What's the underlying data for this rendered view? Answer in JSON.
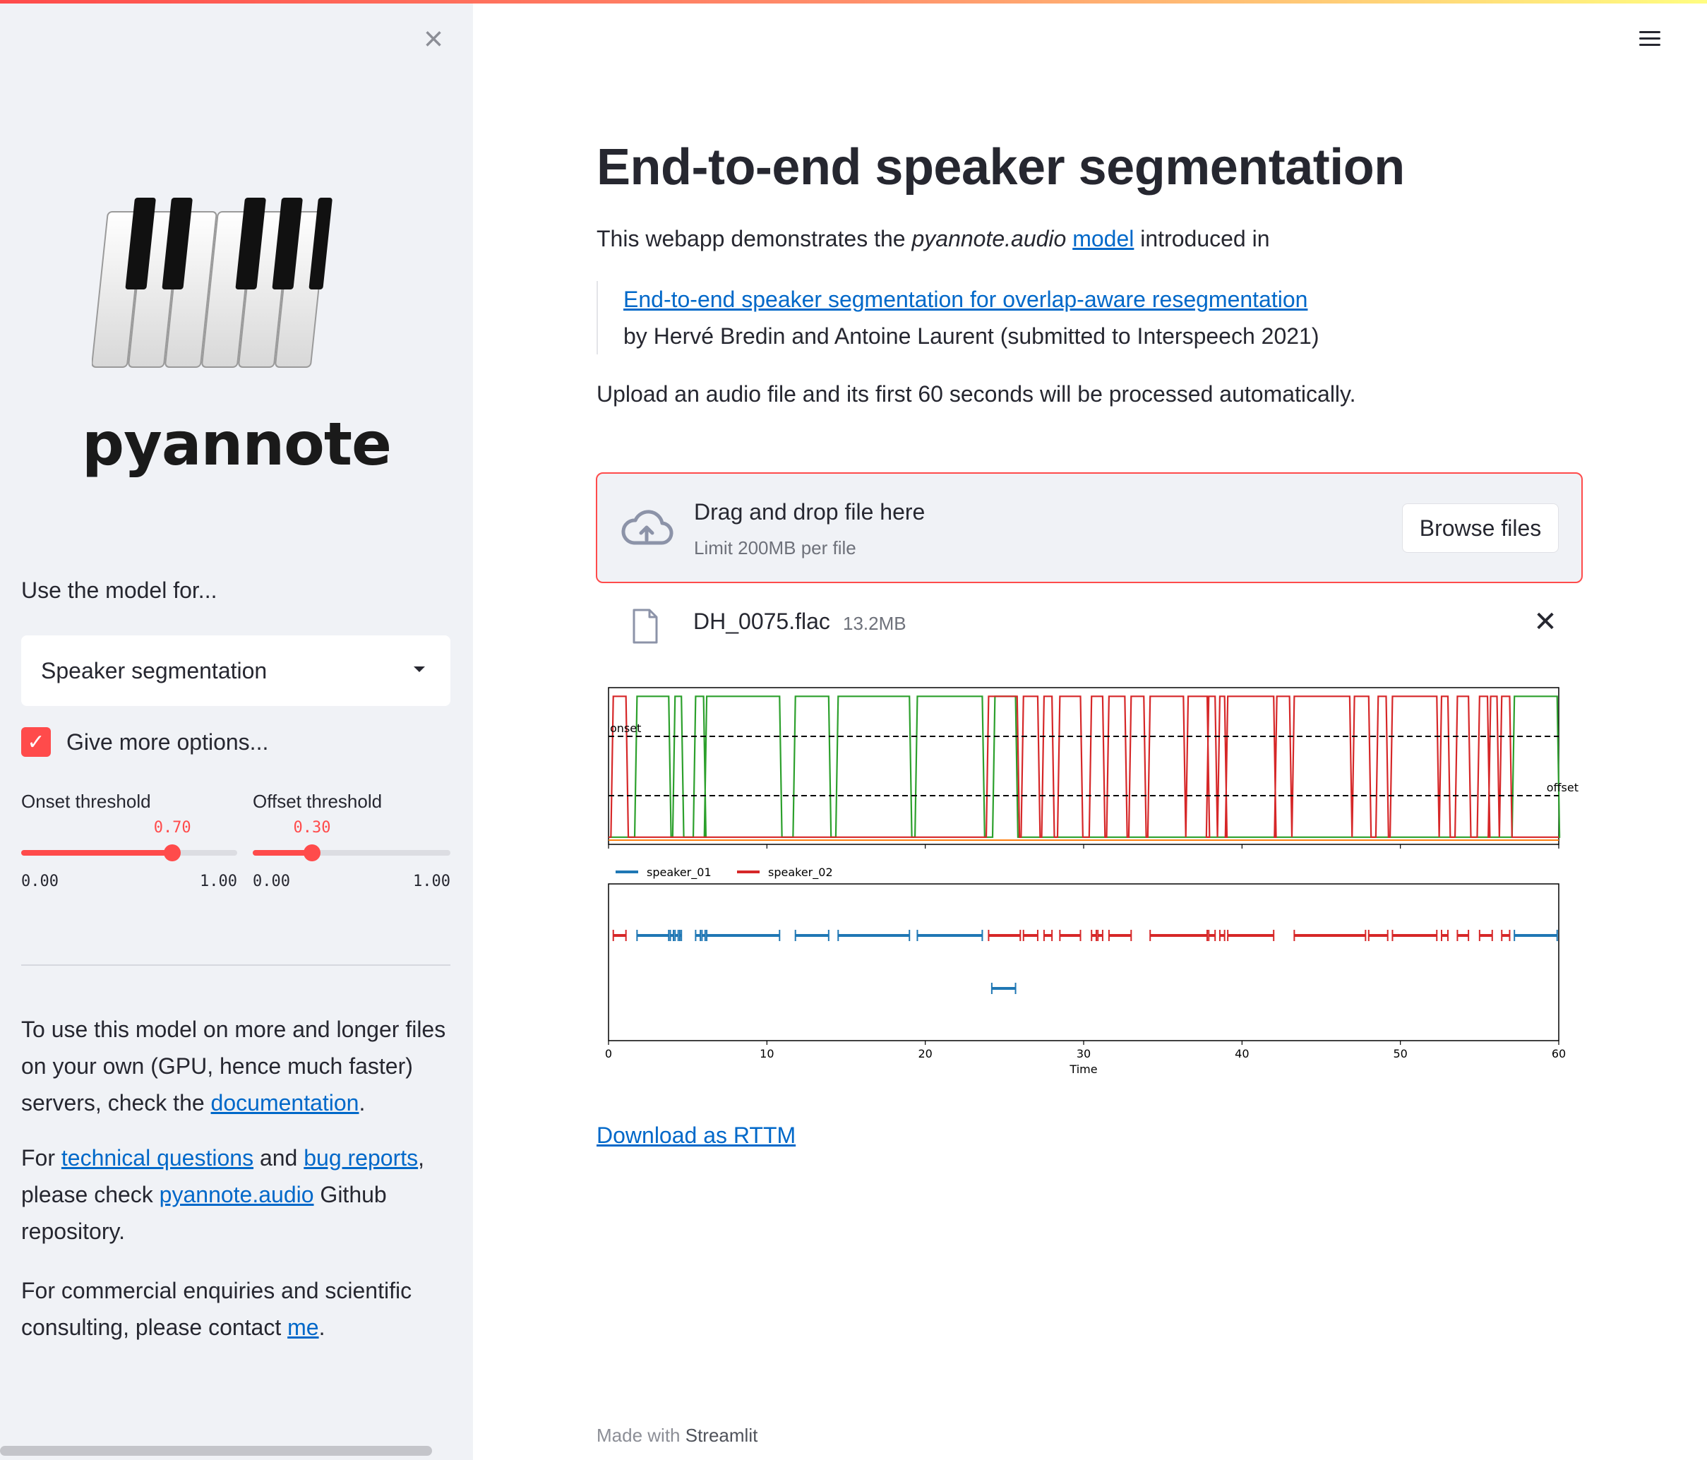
{
  "sidebar": {
    "close_label": "×",
    "logo_text": "pyannote",
    "use_label": "Use the model for...",
    "select_value": "Speaker segmentation",
    "checkbox_label": "Give more options...",
    "onset": {
      "title": "Onset threshold",
      "value": 0.7,
      "value_text": "0.70",
      "min": "0.00",
      "max": "1.00"
    },
    "offset": {
      "title": "Offset threshold",
      "value": 0.3,
      "value_text": "0.30",
      "min": "0.00",
      "max": "1.00"
    },
    "p1": {
      "a": "To use this model on more and longer files on your own (GPU, hence much faster) servers, check the ",
      "link": "documentation",
      "b": "."
    },
    "p2": {
      "a": "For ",
      "link1": "technical questions",
      "b": " and ",
      "link2": "bug reports",
      "c": ", please check ",
      "link3": "pyannote.audio",
      "d": " Github repository."
    },
    "p3": {
      "a": "For commercial enquiries and scientific consulting, please contact ",
      "link": "me",
      "b": "."
    }
  },
  "main": {
    "title": "End-to-end speaker segmentation",
    "intro": {
      "a": "This webapp demonstrates the ",
      "em": "pyannote.audio",
      "link": "model",
      "b": " introduced in"
    },
    "quote": {
      "link": "End-to-end speaker segmentation for overlap-aware resegmentation",
      "by": "by Hervé Bredin and Antoine Laurent (submitted to Interspeech 2021)"
    },
    "upload_note": "Upload an audio file and its first 60 seconds will be processed automatically.",
    "uploader": {
      "title": "Drag and drop file here",
      "limit": "Limit 200MB per file",
      "browse": "Browse files"
    },
    "file": {
      "name": "DH_0075.flac",
      "size": "13.2MB"
    },
    "download": "Download as RTTM",
    "footer": {
      "a": "Made with ",
      "b": "Streamlit"
    }
  },
  "chart_data": {
    "type": "line",
    "onset_label": "onset",
    "offset_label": "offset",
    "onset": 0.7,
    "offset": 0.3,
    "xlabel": "Time",
    "xlim": [
      0,
      60
    ],
    "xticks": [
      0,
      10,
      20,
      30,
      40,
      50,
      60
    ],
    "legend": [
      {
        "name": "speaker_01",
        "color": "#1f77b4"
      },
      {
        "name": "speaker_02",
        "color": "#d62728"
      }
    ],
    "colors": {
      "score_green": "#2ca02c",
      "score_red": "#d62728",
      "score_orange": "#ff7f0e"
    },
    "green_segments": [
      [
        1.8,
        3.8
      ],
      [
        4.2,
        4.6
      ],
      [
        5.5,
        6.0
      ],
      [
        6.2,
        10.8
      ],
      [
        11.8,
        13.9
      ],
      [
        14.5,
        19.0
      ],
      [
        19.5,
        23.6
      ],
      [
        24.4,
        25.7
      ]
    ],
    "red_segments": [
      [
        0.3,
        1.1
      ],
      [
        24.0,
        25.8
      ],
      [
        26.2,
        27.1
      ],
      [
        27.5,
        28.0
      ],
      [
        28.5,
        29.8
      ],
      [
        30.5,
        31.2
      ],
      [
        31.6,
        32.6
      ],
      [
        33.0,
        33.8
      ],
      [
        34.2,
        36.3
      ],
      [
        36.6,
        37.8
      ],
      [
        37.9,
        38.3
      ],
      [
        38.6,
        38.9
      ],
      [
        39.1,
        42.0
      ],
      [
        42.2,
        43.0
      ],
      [
        43.3,
        46.8
      ],
      [
        47.1,
        48.0
      ],
      [
        48.6,
        49.1
      ],
      [
        49.5,
        52.3
      ],
      [
        52.6,
        53.0
      ],
      [
        53.6,
        54.3
      ],
      [
        55.0,
        55.5
      ],
      [
        55.7,
        56.1
      ],
      [
        56.4,
        56.9
      ]
    ],
    "green_tail": [
      [
        57.2,
        59.9
      ]
    ],
    "speaker_01_row1": [
      [
        1.8,
        3.8
      ],
      [
        3.9,
        4.1
      ],
      [
        4.2,
        4.4
      ],
      [
        4.5,
        4.6
      ],
      [
        5.5,
        5.8
      ],
      [
        5.9,
        6.1
      ],
      [
        6.2,
        10.8
      ],
      [
        11.8,
        13.9
      ],
      [
        14.5,
        19.0
      ],
      [
        19.5,
        23.6
      ],
      [
        57.2,
        59.9
      ]
    ],
    "speaker_01_row2": [
      [
        24.2,
        25.7
      ]
    ],
    "speaker_02_row1": [
      [
        0.3,
        1.1
      ],
      [
        24.0,
        26.0
      ],
      [
        26.2,
        27.1
      ],
      [
        27.5,
        28.0
      ],
      [
        28.5,
        29.8
      ],
      [
        30.5,
        30.8
      ],
      [
        30.9,
        31.2
      ],
      [
        31.6,
        33.0
      ],
      [
        34.2,
        37.8
      ],
      [
        37.9,
        38.3
      ],
      [
        38.6,
        38.9
      ],
      [
        39.1,
        42.0
      ],
      [
        43.3,
        47.8
      ],
      [
        48.0,
        49.2
      ],
      [
        49.5,
        52.3
      ],
      [
        52.6,
        53.0
      ],
      [
        53.6,
        54.3
      ],
      [
        55.0,
        55.8
      ],
      [
        56.4,
        56.9
      ]
    ]
  }
}
